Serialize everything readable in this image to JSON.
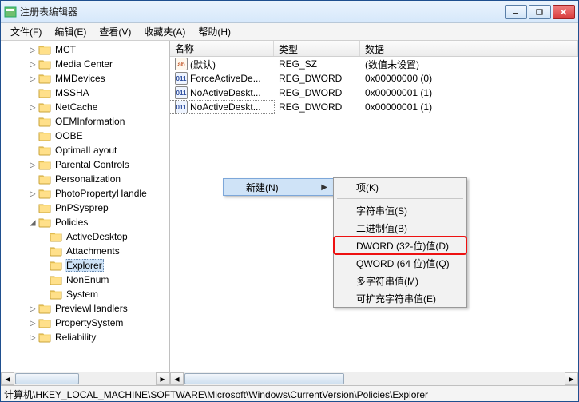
{
  "window": {
    "title": "注册表编辑器"
  },
  "menu": {
    "file": "文件(F)",
    "edit": "编辑(E)",
    "view": "查看(V)",
    "favorites": "收藏夹(A)",
    "help": "帮助(H)"
  },
  "tree": [
    {
      "d": 2,
      "t": 1,
      "l": "MCT"
    },
    {
      "d": 2,
      "t": 1,
      "l": "Media Center"
    },
    {
      "d": 2,
      "t": 1,
      "l": "MMDevices"
    },
    {
      "d": 2,
      "t": 0,
      "l": "MSSHA"
    },
    {
      "d": 2,
      "t": 1,
      "l": "NetCache"
    },
    {
      "d": 2,
      "t": 0,
      "l": "OEMInformation"
    },
    {
      "d": 2,
      "t": 0,
      "l": "OOBE"
    },
    {
      "d": 2,
      "t": 0,
      "l": "OptimalLayout"
    },
    {
      "d": 2,
      "t": 1,
      "l": "Parental Controls"
    },
    {
      "d": 2,
      "t": 0,
      "l": "Personalization"
    },
    {
      "d": 2,
      "t": 1,
      "l": "PhotoPropertyHandle"
    },
    {
      "d": 2,
      "t": 0,
      "l": "PnPSysprep"
    },
    {
      "d": 2,
      "t": 2,
      "l": "Policies"
    },
    {
      "d": 3,
      "t": 0,
      "l": "ActiveDesktop"
    },
    {
      "d": 3,
      "t": 0,
      "l": "Attachments"
    },
    {
      "d": 3,
      "t": 0,
      "l": "Explorer",
      "sel": true
    },
    {
      "d": 3,
      "t": 0,
      "l": "NonEnum"
    },
    {
      "d": 3,
      "t": 0,
      "l": "System"
    },
    {
      "d": 2,
      "t": 1,
      "l": "PreviewHandlers"
    },
    {
      "d": 2,
      "t": 1,
      "l": "PropertySystem"
    },
    {
      "d": 2,
      "t": 1,
      "l": "Reliability"
    }
  ],
  "list": {
    "headers": {
      "name": "名称",
      "type": "类型",
      "data": "数据"
    },
    "rows": [
      {
        "icon": "sz",
        "name": "(默认)",
        "type": "REG_SZ",
        "data": "(数值未设置)"
      },
      {
        "icon": "dw",
        "name": "ForceActiveDe...",
        "type": "REG_DWORD",
        "data": "0x00000000 (0)"
      },
      {
        "icon": "dw",
        "name": "NoActiveDeskt...",
        "type": "REG_DWORD",
        "data": "0x00000001 (1)"
      },
      {
        "icon": "dw",
        "name": "NoActiveDeskt...",
        "type": "REG_DWORD",
        "data": "0x00000001 (1)",
        "sel": true
      }
    ]
  },
  "icon_text": {
    "sz": "ab",
    "dw": "011"
  },
  "ctx": {
    "new": "新建(N)",
    "sub": {
      "key": "项(K)",
      "string": "字符串值(S)",
      "binary": "二进制值(B)",
      "dword": "DWORD (32-位)值(D)",
      "qword": "QWORD (64 位)值(Q)",
      "multi": "多字符串值(M)",
      "expand": "可扩充字符串值(E)"
    }
  },
  "status": "计算机\\HKEY_LOCAL_MACHINE\\SOFTWARE\\Microsoft\\Windows\\CurrentVersion\\Policies\\Explorer"
}
